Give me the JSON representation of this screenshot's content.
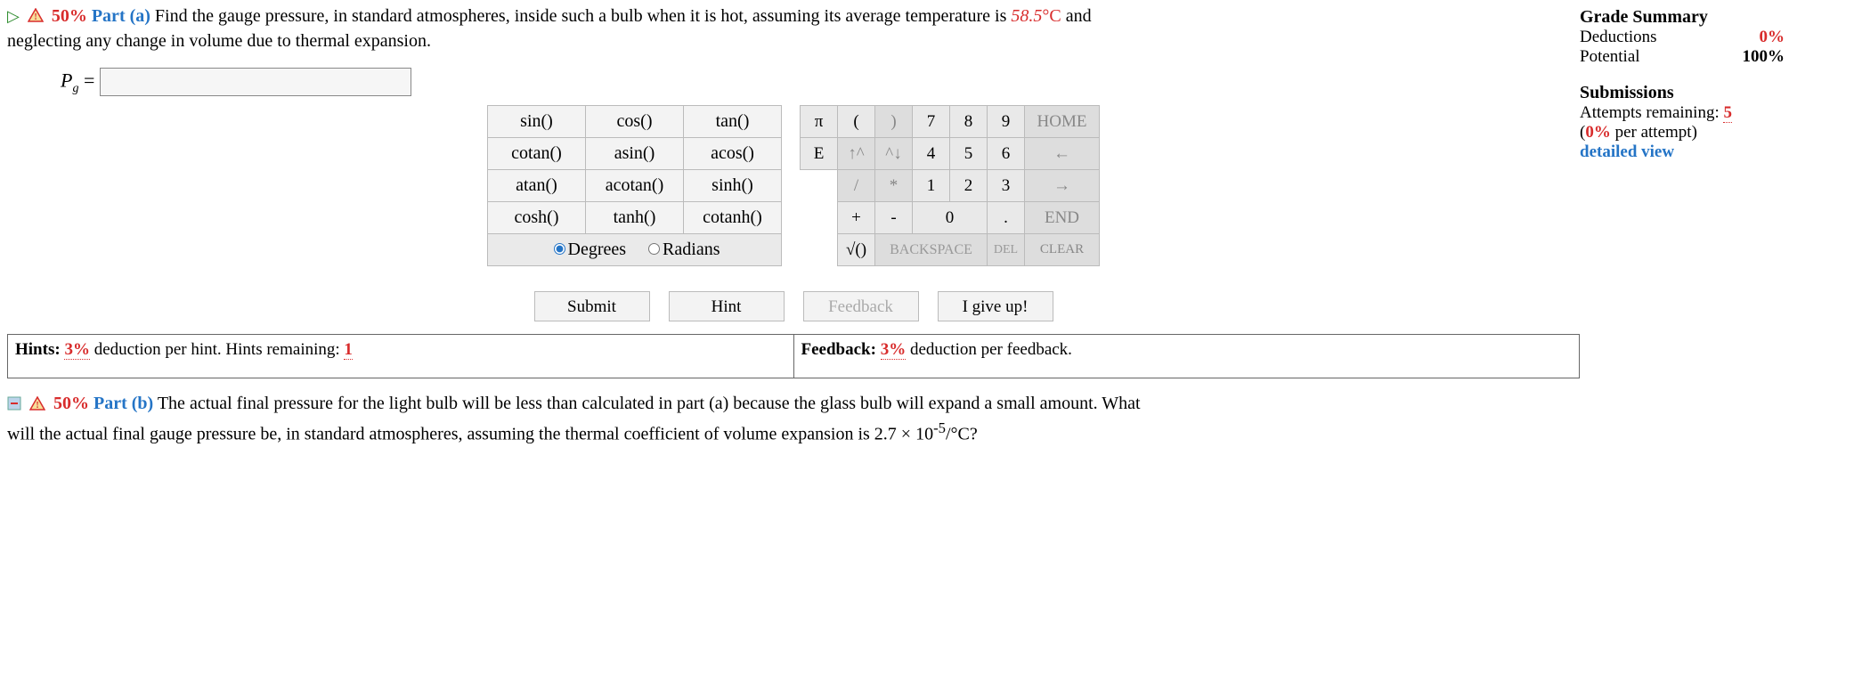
{
  "partA": {
    "percent": "50%",
    "label": "Part (a)",
    "text1": "Find the gauge pressure, in standard atmospheres, inside such a bulb when it is hot, assuming its average temperature is ",
    "temp": "58.5",
    "deg": "°C",
    "text2": " and",
    "text3": "neglecting any change in volume due to thermal expansion."
  },
  "answer": {
    "varBase": "P",
    "varSub": "g",
    "equals": " = ",
    "value": ""
  },
  "grade": {
    "title": "Grade Summary",
    "deductions_label": "Deductions",
    "deductions_value": "0%",
    "potential_label": "Potential",
    "potential_value": "100%"
  },
  "subs": {
    "title": "Submissions",
    "attempts_label": "Attempts remaining: ",
    "attempts_value": "5",
    "per_attempt": "(0% per attempt)",
    "detailed": "detailed view"
  },
  "func": {
    "r1c1": "sin()",
    "r1c2": "cos()",
    "r1c3": "tan()",
    "r2c1": "cotan()",
    "r2c2": "asin()",
    "r2c3": "acos()",
    "r3c1": "atan()",
    "r3c2": "acotan()",
    "r3c3": "sinh()",
    "r4c1": "cosh()",
    "r4c2": "tanh()",
    "r4c3": "cotanh()",
    "degrees": "Degrees",
    "radians": "Radians"
  },
  "num": {
    "pi": "π",
    "lp": "(",
    "rp": ")",
    "n7": "7",
    "n8": "8",
    "n9": "9",
    "home": "HOME",
    "E": "E",
    "upc": "↑^",
    "dnc": "^↓",
    "n4": "4",
    "n5": "5",
    "n6": "6",
    "larr": "←",
    "slash": "/",
    "star": "*",
    "n1": "1",
    "n2": "2",
    "n3": "3",
    "rarr": "→",
    "plus": "+",
    "minus": "-",
    "n0": "0",
    "dot": ".",
    "end": "END",
    "sqrt": "√()",
    "bksp": "BACKSPACE",
    "del": "DEL",
    "clear": "CLEAR"
  },
  "actions": {
    "submit": "Submit",
    "hint": "Hint",
    "feedback": "Feedback",
    "giveup": "I give up!"
  },
  "hints": {
    "left_bold": "Hints: ",
    "left_pct": "3%",
    "left_text": " deduction per hint. Hints remaining: ",
    "left_rem": "1",
    "right_bold": "Feedback: ",
    "right_pct": "3%",
    "right_text": " deduction per feedback."
  },
  "partB": {
    "percent": "50%",
    "label": "Part (b)",
    "text1": "The actual final pressure for the light bulb will be less than calculated in part (a) because the glass bulb will expand a small amount. What",
    "text2a": "will the actual final gauge pressure be, in standard atmospheres, assuming the thermal coefficient of volume expansion is 2.7 × 10",
    "exp": "-5",
    "text2b": "/°C?"
  }
}
